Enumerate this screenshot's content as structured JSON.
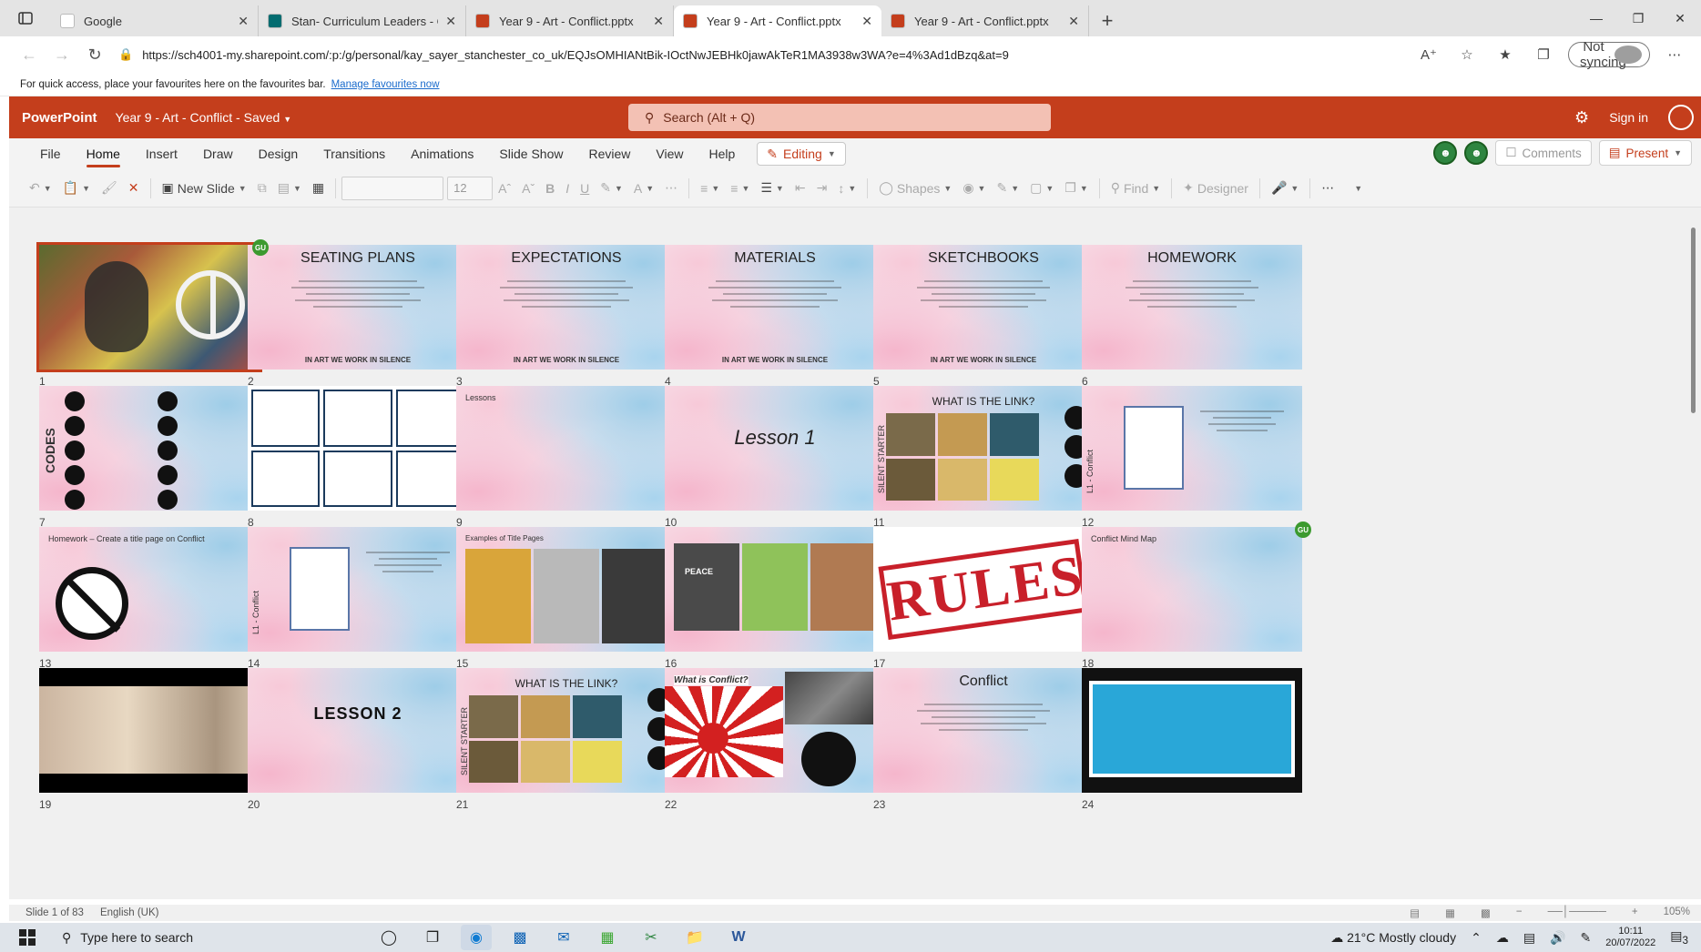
{
  "browser": {
    "tabs": [
      {
        "title": "Google",
        "color": "#ffffff",
        "active": false
      },
      {
        "title": "Stan- Curriculum Leaders - Creat",
        "color": "#036c70",
        "active": false
      },
      {
        "title": "Year 9 - Art - Conflict.pptx",
        "color": "#c43e1c",
        "active": false
      },
      {
        "title": "Year 9 - Art - Conflict.pptx",
        "color": "#c43e1c",
        "active": true
      },
      {
        "title": "Year 9 - Art - Conflict.pptx",
        "color": "#c43e1c",
        "active": false
      }
    ],
    "url": "https://sch4001-my.sharepoint.com/:p:/g/personal/kay_sayer_stanchester_co_uk/EQJsOMHIANtBik-IOctNwJEBHk0jawAkTeR1MA3938w3WA?e=4%3Ad1dBzq&at=9",
    "sync_label": "Not syncing",
    "favourites_text": "For quick access, place your favourites here on the favourites bar.",
    "favourites_link": "Manage favourites now"
  },
  "app": {
    "brand": "PowerPoint",
    "doc_title": "Year 9 - Art - Conflict - Saved",
    "search_placeholder": "Search (Alt + Q)",
    "sign_in": "Sign in",
    "accent": "#c43e1c"
  },
  "ribbon_tabs": [
    "File",
    "Home",
    "Insert",
    "Draw",
    "Design",
    "Transitions",
    "Animations",
    "Slide Show",
    "Review",
    "View",
    "Help"
  ],
  "active_tab": "Home",
  "editing_label": "Editing",
  "comments_label": "Comments",
  "present_label": "Present",
  "ribbon": {
    "new_slide": "New Slide",
    "font_size": "12",
    "shapes": "Shapes",
    "find": "Find",
    "designer": "Designer"
  },
  "slides": [
    {
      "num": "1",
      "title": "",
      "footer": "",
      "kind": "art"
    },
    {
      "num": "2",
      "title": "SEATING PLANS",
      "footer": "IN ART WE WORK IN SILENCE",
      "kind": "text"
    },
    {
      "num": "3",
      "title": "EXPECTATIONS",
      "footer": "IN ART WE WORK IN SILENCE",
      "kind": "text"
    },
    {
      "num": "4",
      "title": "MATERIALS",
      "footer": "IN ART WE WORK IN SILENCE",
      "kind": "text"
    },
    {
      "num": "5",
      "title": "SKETCHBOOKS",
      "footer": "IN ART WE WORK IN SILENCE",
      "kind": "text"
    },
    {
      "num": "6",
      "title": "HOMEWORK",
      "footer": "",
      "kind": "text"
    },
    {
      "num": "7",
      "title": "CODES",
      "footer": "",
      "kind": "codes"
    },
    {
      "num": "8",
      "title": "",
      "footer": "",
      "kind": "grid"
    },
    {
      "num": "9",
      "title": "Lessons",
      "footer": "",
      "kind": "small"
    },
    {
      "num": "10",
      "title": "Lesson 1",
      "footer": "",
      "kind": "lesson1"
    },
    {
      "num": "11",
      "title": "WHAT IS THE LINK?",
      "footer": "SILENT STARTER",
      "kind": "link"
    },
    {
      "num": "12",
      "title": "L1 - Conflict",
      "footer": "",
      "kind": "paper"
    },
    {
      "num": "13",
      "title": "Homework – Create a title page on Conflict",
      "footer": "",
      "kind": "nodog"
    },
    {
      "num": "14",
      "title": "L1 - Conflict",
      "footer": "",
      "kind": "paper"
    },
    {
      "num": "15",
      "title": "Examples of Title Pages",
      "footer": "",
      "kind": "examples"
    },
    {
      "num": "16",
      "title": "PEACE",
      "footer": "",
      "kind": "collage"
    },
    {
      "num": "17",
      "title": "RULES",
      "footer": "",
      "kind": "rules"
    },
    {
      "num": "18",
      "title": "Conflict Mind Map",
      "footer": "",
      "kind": "small"
    },
    {
      "num": "19",
      "title": "",
      "footer": "",
      "kind": "dark"
    },
    {
      "num": "20",
      "title": "LESSON 2",
      "footer": "",
      "kind": "lesson2"
    },
    {
      "num": "21",
      "title": "WHAT IS THE LINK?",
      "footer": "SILENT STARTER",
      "kind": "link"
    },
    {
      "num": "22",
      "title": "What is Conflict?",
      "footer": "",
      "kind": "conflictq"
    },
    {
      "num": "23",
      "title": "Conflict",
      "footer": "",
      "kind": "text"
    },
    {
      "num": "24",
      "title": "",
      "footer": "",
      "kind": "whiteboard"
    }
  ],
  "presence_badge": "GU",
  "status": {
    "slide_of": "Slide 1 of 83",
    "language": "English (UK)",
    "zoom": "105%"
  },
  "taskbar": {
    "search_placeholder": "Type here to search",
    "weather": "21°C  Mostly cloudy",
    "time": "10:11",
    "date": "20/07/2022",
    "notifications": "3"
  }
}
